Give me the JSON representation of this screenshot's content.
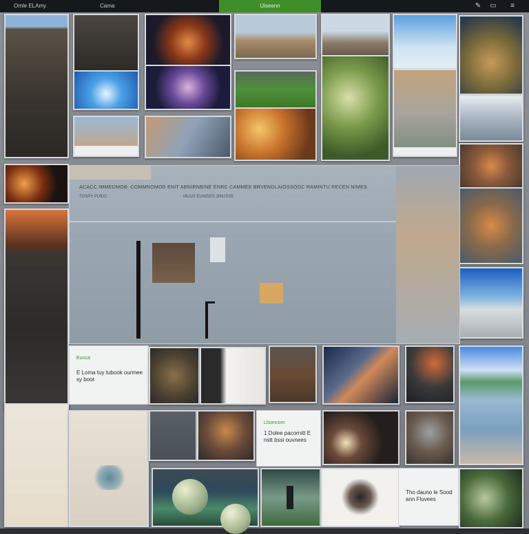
{
  "topbar": {
    "left_text": "Omle ELAmy",
    "mid_text": "Cama",
    "active_tab": "Uiseenn"
  },
  "icons": [
    "pen-icon",
    "screen-icon",
    "menu-icon"
  ],
  "panel": {
    "line1": "ACACC IMMEDMOB: COMMNOMOB ENIT ABNIRNBINE ENRC CAMMEE BRVENDLAIOSSOOC RAMINTU RECEN NIMES",
    "line2": "TOSPY PUIDC",
    "line3": "MUUS EUNIDES 3INUSSE"
  },
  "cards": [
    {
      "label": "Eunca",
      "text": "E Loma tuy tubook ourmee sy boot"
    },
    {
      "label": "Llooncom",
      "text": "1 Dolee pacornitt E nstt bssi ouvnees"
    },
    {
      "label": "",
      "text": "Tho dauno le Sood ann Fluvees"
    }
  ],
  "colors": {
    "topbar_bg": "#16191c",
    "active_tab": "#3e8f2a",
    "canvas": "#858a90"
  }
}
